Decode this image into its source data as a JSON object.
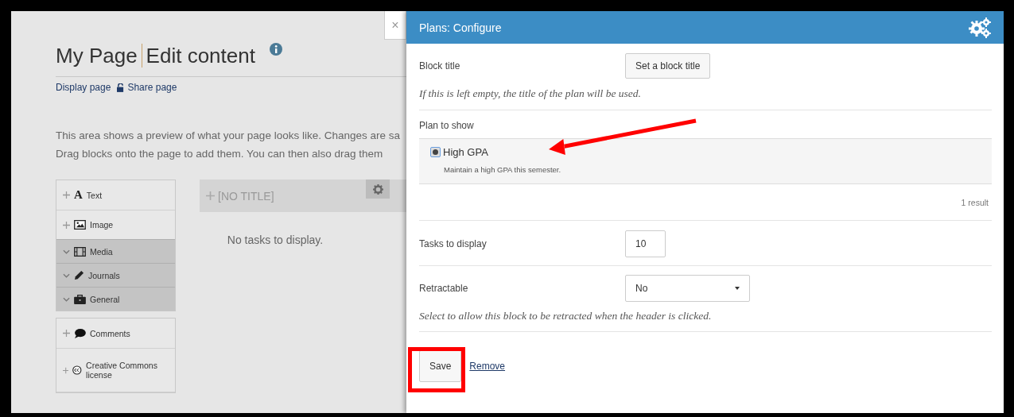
{
  "page": {
    "title": "My Page",
    "subtitle": "Edit content",
    "links": [
      {
        "label": "Display page",
        "kind": "plain"
      },
      {
        "label": "Share page",
        "kind": "unlocked"
      }
    ],
    "intro_lines": [
      "This area shows a preview of what your page looks like. Changes are sa",
      "Drag blocks onto the page to add them. You can then also drag them"
    ],
    "block_groups": [
      [
        {
          "label": "Text",
          "kind": "block",
          "glyph": "A"
        },
        {
          "label": "Image",
          "kind": "block"
        },
        {
          "label": "Media",
          "kind": "category"
        },
        {
          "label": "Journals",
          "kind": "category"
        },
        {
          "label": "General",
          "kind": "category"
        }
      ],
      [
        {
          "label": "Comments",
          "kind": "block"
        },
        {
          "label": "Creative Commons license",
          "kind": "block"
        }
      ]
    ],
    "preview_block": {
      "title": "[NO TITLE]",
      "empty_text": "No tasks to display."
    },
    "close_button": "×"
  },
  "dialog": {
    "title": "Plans: Configure",
    "block_title": {
      "label": "Block title",
      "button": "Set a block title",
      "help": "If this is left empty, the title of the plan will be used."
    },
    "plan": {
      "label": "Plan to show",
      "options": [
        {
          "name": "High GPA",
          "description": "Maintain a high GPA this semester.",
          "selected": true
        }
      ],
      "result_count": "1 result"
    },
    "tasks": {
      "label": "Tasks to display",
      "value": "10"
    },
    "retractable": {
      "label": "Retractable",
      "value": "No",
      "help": "Select to allow this block to be retracted when the header is clicked."
    },
    "save_button": "Save",
    "remove_link": "Remove"
  }
}
